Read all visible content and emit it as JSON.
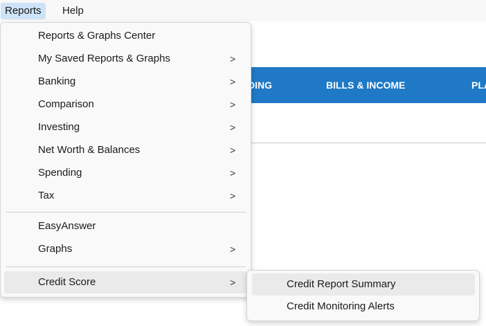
{
  "menubar": {
    "reports": "Reports",
    "help": "Help"
  },
  "nav": {
    "tab_spending": "DING",
    "tab_bills": "BILLS & INCOME",
    "tab_planning": "PLA"
  },
  "reports_menu": {
    "items": [
      {
        "label": "Reports & Graphs Center",
        "has_submenu": false
      },
      {
        "label": "My Saved Reports & Graphs",
        "has_submenu": true
      },
      {
        "label": "Banking",
        "has_submenu": true
      },
      {
        "label": "Comparison",
        "has_submenu": true
      },
      {
        "label": "Investing",
        "has_submenu": true
      },
      {
        "label": "Net Worth & Balances",
        "has_submenu": true
      },
      {
        "label": "Spending",
        "has_submenu": true
      },
      {
        "label": "Tax",
        "has_submenu": true
      },
      {
        "label": "EasyAnswer",
        "has_submenu": false
      },
      {
        "label": "Graphs",
        "has_submenu": true
      },
      {
        "label": "Credit Score",
        "has_submenu": true
      }
    ],
    "chevron": ">"
  },
  "credit_score_submenu": {
    "items": [
      {
        "label": "Credit Report Summary"
      },
      {
        "label": "Credit Monitoring Alerts"
      }
    ]
  },
  "colors": {
    "accent": "#1f79c6",
    "menu_active": "#cde3f7",
    "menu_hover": "#eaeaea"
  }
}
